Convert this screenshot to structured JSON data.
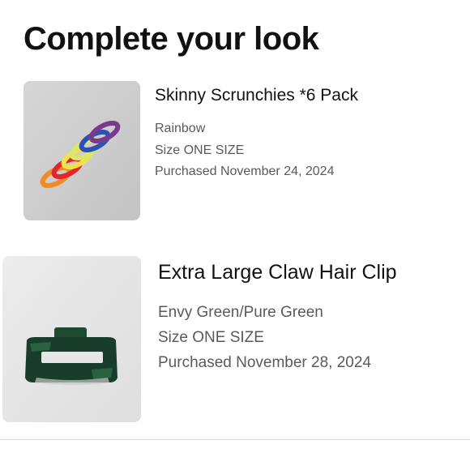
{
  "section": {
    "title": "Complete your look"
  },
  "products": [
    {
      "name": "Skinny Scrunchies *6 Pack",
      "color": "Rainbow",
      "size": "Size ONE SIZE",
      "purchased": "Purchased November 24, 2024",
      "image_icon": "scrunchies-image"
    },
    {
      "name": "Extra Large Claw Hair Clip",
      "color": "Envy Green/Pure Green",
      "size": "Size ONE SIZE",
      "purchased": "Purchased November 28, 2024",
      "image_icon": "claw-clip-image"
    }
  ],
  "colors": {
    "background": "#ffffff",
    "title": "#111111",
    "meta_text": "#5a5a5a",
    "divider": "#dcdcdc"
  }
}
